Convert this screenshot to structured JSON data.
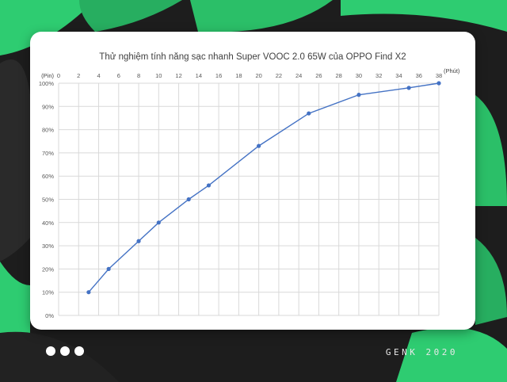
{
  "colors": {
    "accent": "#2ecc71",
    "line": "#4472c4",
    "background": "#1d1d1d",
    "card": "#ffffff"
  },
  "footer": {
    "brand": "GENK 2020",
    "dots_icon": "three-dots-icon"
  },
  "chart_data": {
    "type": "line",
    "title": "Thử nghiệm tính năng sạc nhanh Super VOOC 2.0 65W của OPPO Find X2",
    "xlabel": "(Phút)",
    "ylabel": "(Pin)",
    "xlim": [
      0,
      38
    ],
    "ylim": [
      0,
      100
    ],
    "x_ticks": [
      0,
      2,
      4,
      6,
      8,
      10,
      12,
      14,
      16,
      18,
      20,
      22,
      24,
      26,
      28,
      30,
      32,
      34,
      36,
      38
    ],
    "y_ticks": [
      "0%",
      "10%",
      "20%",
      "30%",
      "40%",
      "50%",
      "60%",
      "70%",
      "80%",
      "90%",
      "100%"
    ],
    "x_axis_position": "top",
    "grid": true,
    "series": [
      {
        "x": [
          3,
          5,
          8,
          10,
          13,
          15,
          20,
          25,
          30,
          35,
          38
        ],
        "y": [
          10,
          20,
          32,
          40,
          50,
          56,
          73,
          87,
          95,
          98,
          100
        ]
      }
    ]
  }
}
